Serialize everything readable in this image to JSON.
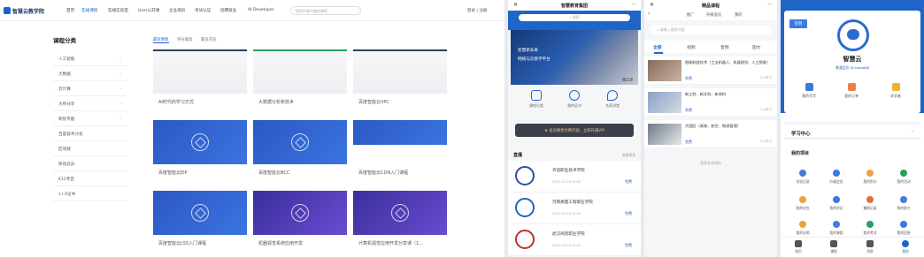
{
  "pc": {
    "logo": "智慧云教学院",
    "nav": [
      "首页",
      "在线课程",
      "在线实验室",
      "User公开课",
      "企业培训",
      "考试认证",
      "招聘就业",
      "AI Developer"
    ],
    "search_placeholder": "搜索你感兴趣的课程",
    "login": "登录 | 注册",
    "category_title": "课程分类",
    "categories": [
      "人工智能",
      "大数据",
      "云计算",
      "大师分享",
      "新技专题",
      "百度技术沙龙",
      "区块链",
      "移动云员",
      "K12专区",
      "1+X证书"
    ],
    "sort": [
      "最近更新",
      "评分最高",
      "最多浏览"
    ],
    "cards": [
      {
        "caption": "AI时代的学习方式",
        "style": "white"
      },
      {
        "caption": "大数据分析新技术",
        "style": "white"
      },
      {
        "caption": "百度智能云VPC",
        "style": "white"
      },
      {
        "caption": "百度智能云EIP",
        "style": "blue"
      },
      {
        "caption": "百度智能云BCC",
        "style": "blue"
      },
      {
        "caption": "百度智能云CDN入门课程",
        "style": "blue"
      },
      {
        "caption": "百度智能云LSS入门课程",
        "style": "blue"
      },
      {
        "caption": "机器视觉系统应用开发",
        "style": "purple"
      },
      {
        "caption": "计算机视觉应用开发分享课（1...",
        "style": "purple"
      }
    ]
  },
  "phone1": {
    "title": "智慧教育集团",
    "search": "搜索",
    "banner_line1": "智慧新未来",
    "banner_line2": "网络与云教学平台",
    "banner_page": "1/3",
    "icons": [
      "课程分类",
      "我的证书",
      "名家讲堂"
    ],
    "vip": "会员畅享付费内容，立即开通VIP",
    "live_title": "直播",
    "live_more": "查看更多",
    "lives": [
      {
        "name": "许昌职业技术学院",
        "date": "2021-03-16 10:00",
        "free": "免费"
      },
      {
        "name": "河南质量工程职业学院",
        "date": "2021-03-16 10:00",
        "free": "免费"
      },
      {
        "name": "武汉商贸职业学院",
        "date": "2021-03-16 10:00",
        "free": "免费"
      }
    ]
  },
  "phone2": {
    "title": "精品课程",
    "subtabs": [
      "推广",
      "升级会员",
      "我的"
    ],
    "search": "请输入搜索内容",
    "tabs": [
      "全部",
      "视频",
      "音频",
      "图文"
    ],
    "courses": [
      {
        "title": "智能制造技术（工业机器人、机器视觉、人工智能）",
        "free": "免费",
        "count": "2人学习"
      },
      {
        "title": "新工科、新文科、新商科",
        "free": "免费",
        "count": "1人学习"
      },
      {
        "title": "大国匠（高铁、航空、物流管理）",
        "free": "免费",
        "count": "2人学习"
      }
    ],
    "nomore": "我是有底线的"
  },
  "phone3": {
    "sign": "签到",
    "name": "智慧云",
    "member": "普通会员  ID:sheep88",
    "actions": [
      "我的写字",
      "我的订单",
      "求学者"
    ],
    "study": "学习中心",
    "projects_title": "我的项目",
    "grid": [
      "浏览记录",
      "升级会员",
      "我的积分",
      "我的活动",
      "我的红包",
      "我的评论",
      "播放记录",
      "我的助力",
      "我的分销",
      "我的课程",
      "我的考试",
      "我的回答"
    ],
    "grid_colors": [
      "#4a7ae0",
      "#3a7ae0",
      "#f0a040",
      "#2aa060",
      "#f0a040",
      "#3a7ae0",
      "#e07040",
      "#4a7ae0",
      "#f0a040",
      "#4a7ae0",
      "#2aa060",
      "#3a7ae0"
    ],
    "tabbar": [
      "首页",
      "课程",
      "消息",
      "我的"
    ]
  }
}
